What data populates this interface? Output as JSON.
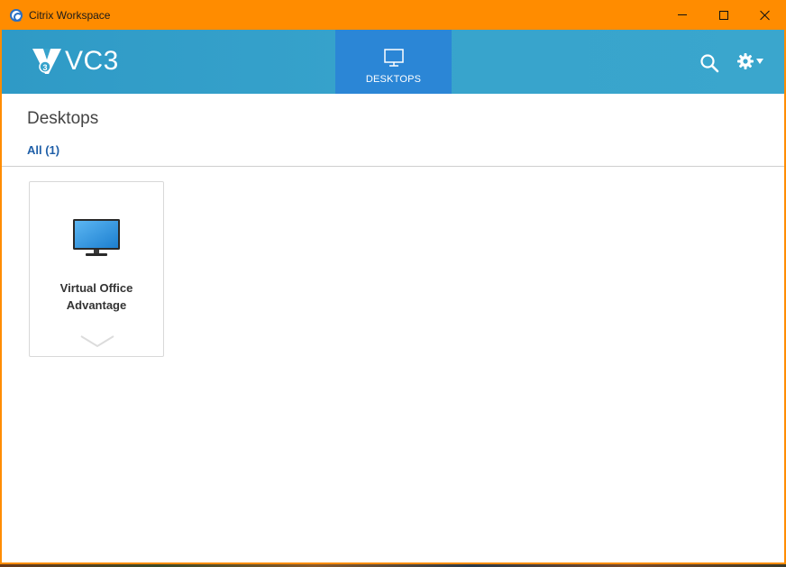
{
  "window": {
    "title": "Citrix Workspace",
    "controls": [
      "minimize",
      "maximize",
      "close"
    ],
    "accent_color": "#ff8c00"
  },
  "header": {
    "logo_text": "VC3",
    "logo_badge": "3",
    "tabs": [
      {
        "label": "DESKTOPS",
        "icon": "monitor-icon",
        "selected": true
      }
    ],
    "actions": [
      {
        "name": "search",
        "icon": "search-icon"
      },
      {
        "name": "settings",
        "icon": "gear-icon"
      }
    ],
    "band_color": "#37a3cc",
    "active_tab_color": "#2b86d6"
  },
  "main": {
    "page_title": "Desktops",
    "filter_label": "All (1)",
    "desktops": [
      {
        "name": "Virtual Office Advantage",
        "icon": "monitor-icon"
      }
    ]
  }
}
